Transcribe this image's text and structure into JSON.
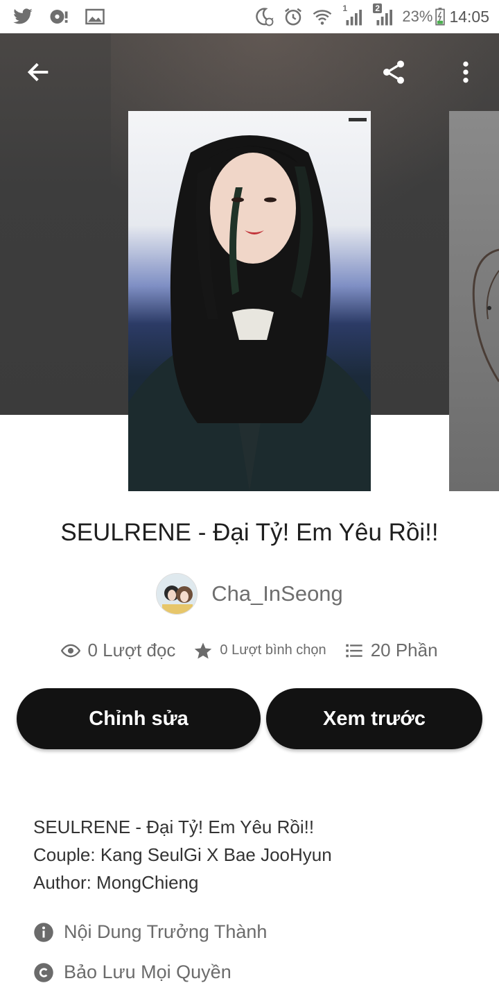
{
  "status_bar": {
    "signal1_label": "1",
    "signal2_label": "2",
    "battery": "23%",
    "time": "14:05"
  },
  "story": {
    "title": "SEULRENE - Đại Tỷ! Em Yêu Rồi!!",
    "author": "Cha_InSeong",
    "stats": {
      "reads": "0 Lượt đọc",
      "votes": "0 Lượt bình chọn",
      "parts": "20 Phần"
    },
    "description": [
      "SEULRENE - Đại Tỷ! Em Yêu Rồi!!",
      "Couple: Kang SeulGi X Bae JooHyun",
      "Author: MongChieng"
    ],
    "mature": "Nội Dung Trưởng Thành",
    "copyright": "Bảo Lưu Mọi Quyền"
  },
  "actions": {
    "edit": "Chỉnh sửa",
    "preview": "Xem trước"
  },
  "colors": {
    "button_bg": "#121212",
    "header_bg": "#3b3b3b",
    "muted_text": "#6b6b6b"
  }
}
